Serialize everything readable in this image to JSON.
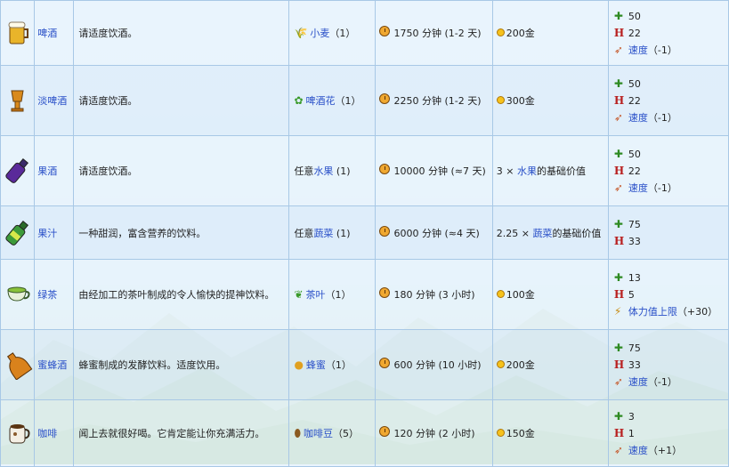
{
  "rows": [
    {
      "name": "啤酒",
      "desc": "请适度饮酒。",
      "ing_icon": "wheat-icon",
      "ing_label": "小麦",
      "ing_qty": "（1）",
      "ing_is_link": true,
      "time": "1750 分钟 (1-2 天)",
      "price": "200金",
      "price_has_coin": true,
      "stats": [
        {
          "icon": "energy-plus-icon",
          "text": "50"
        },
        {
          "icon": "health-icon",
          "text": "22"
        },
        {
          "icon": "speed-icon",
          "label": "速度",
          "value": "（-1）"
        }
      ]
    },
    {
      "name": "淡啤酒",
      "desc": "请适度饮酒。",
      "ing_icon": "hops-icon",
      "ing_label": "啤酒花",
      "ing_qty": "（1）",
      "ing_is_link": true,
      "time": "2250 分钟 (1-2 天)",
      "price": "300金",
      "price_has_coin": true,
      "stats": [
        {
          "icon": "energy-plus-icon",
          "text": "50"
        },
        {
          "icon": "health-icon",
          "text": "22"
        },
        {
          "icon": "speed-icon",
          "label": "速度",
          "value": "（-1）"
        }
      ]
    },
    {
      "name": "果酒",
      "desc": "请适度饮酒。",
      "ing_prefix": "任意",
      "ing_label": "水果",
      "ing_qty": " (1)",
      "ing_is_link": true,
      "time": "10000 分钟 (≈7 天)",
      "price_prefix": "3 × ",
      "price": "水果",
      "price_suffix": "的基础价值",
      "price_has_coin": false,
      "stats": [
        {
          "icon": "energy-plus-icon",
          "text": "50"
        },
        {
          "icon": "health-icon",
          "text": "22"
        },
        {
          "icon": "speed-icon",
          "label": "速度",
          "value": "（-1）"
        }
      ]
    },
    {
      "name": "果汁",
      "desc": "一种甜润，富含营养的饮料。",
      "ing_prefix": "任意",
      "ing_label": "蔬菜",
      "ing_qty": " (1)",
      "ing_is_link": true,
      "time": "6000 分钟 (≈4 天)",
      "price_prefix": "2.25 × ",
      "price": "蔬菜",
      "price_suffix": "的基础价值",
      "price_has_coin": false,
      "stats": [
        {
          "icon": "energy-plus-icon",
          "text": "75"
        },
        {
          "icon": "health-icon",
          "text": "33"
        }
      ]
    },
    {
      "name": "绿茶",
      "desc": "由经加工的茶叶制成的令人愉快的提神饮料。",
      "ing_icon": "tea-leaves-icon",
      "ing_label": "茶叶",
      "ing_qty": "（1）",
      "ing_is_link": true,
      "time": "180 分钟 (3 小时)",
      "price": "100金",
      "price_has_coin": true,
      "stats": [
        {
          "icon": "energy-plus-icon",
          "text": "13"
        },
        {
          "icon": "health-icon",
          "text": "5"
        },
        {
          "icon": "max-energy-icon",
          "label": "体力值上限",
          "value": "（+30）"
        }
      ]
    },
    {
      "name": "蜜蜂酒",
      "desc": "蜂蜜制成的发酵饮料。适度饮用。",
      "ing_icon": "honey-icon",
      "ing_label": "蜂蜜",
      "ing_qty": "（1）",
      "ing_is_link": true,
      "time": "600 分钟 (10 小时)",
      "price": "200金",
      "price_has_coin": true,
      "stats": [
        {
          "icon": "energy-plus-icon",
          "text": "75"
        },
        {
          "icon": "health-icon",
          "text": "33"
        },
        {
          "icon": "speed-icon",
          "label": "速度",
          "value": "（-1）"
        }
      ]
    },
    {
      "name": "咖啡",
      "desc": "闻上去就很好喝。它肯定能让你充满活力。",
      "ing_icon": "coffee-bean-icon",
      "ing_label": "咖啡豆",
      "ing_qty": "（5）",
      "ing_is_link": true,
      "time": "120 分钟 (2 小时)",
      "price": "150金",
      "price_has_coin": true,
      "stats": [
        {
          "icon": "energy-plus-icon",
          "text": "3"
        },
        {
          "icon": "health-icon",
          "text": "1"
        },
        {
          "icon": "speed-icon",
          "label": "速度",
          "value": "（+1）"
        }
      ]
    }
  ],
  "colors": {
    "link": "#2a50c8",
    "border": "#a8c8e6",
    "energy": "#2e8a22",
    "health": "#b82020",
    "coin": "#f6c21c"
  }
}
